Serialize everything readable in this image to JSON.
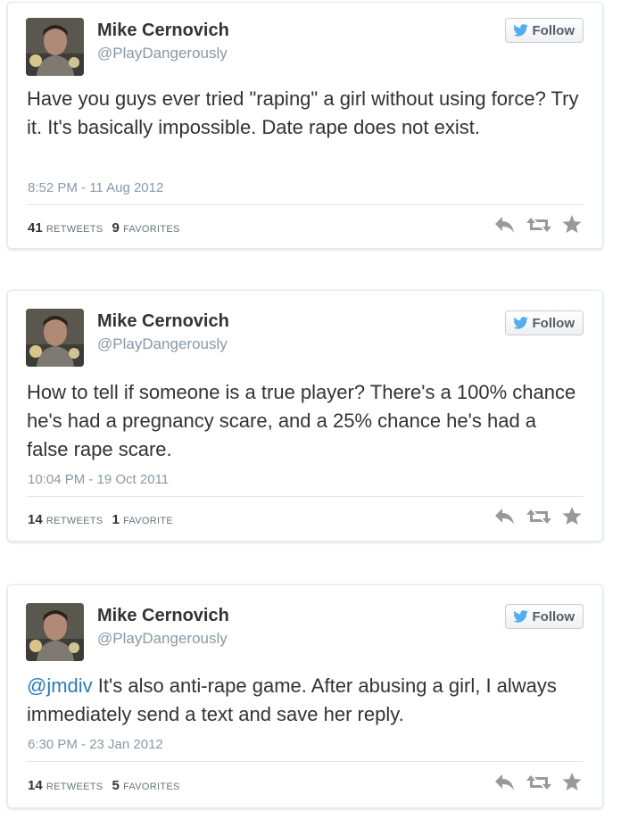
{
  "tweets": [
    {
      "name": "Mike Cernovich",
      "handle": "@PlayDangerously",
      "follow_label": "Follow",
      "text": "Have you guys ever tried \"raping\" a girl without using force? Try it. It's basically impossible. Date rape does not exist.",
      "timestamp": "8:52 PM - 11 Aug 2012",
      "retweets_count": "41",
      "retweets_label": "Retweets",
      "favorites_count": "9",
      "favorites_label": "Favorites"
    },
    {
      "name": "Mike Cernovich",
      "handle": "@PlayDangerously",
      "follow_label": "Follow",
      "text": "How to tell if someone is a true player? There's a 100% chance he's had a pregnancy scare, and a 25% chance he's had a false rape scare.",
      "timestamp": "10:04 PM - 19 Oct 2011",
      "retweets_count": "14",
      "retweets_label": "Retweets",
      "favorites_count": "1",
      "favorites_label": "Favorite"
    },
    {
      "name": "Mike Cernovich",
      "handle": "@PlayDangerously",
      "follow_label": "Follow",
      "mention": "@jmdiv",
      "text": "It's also anti-rape game. After abusing a girl, I always immediately send a text and save her reply.",
      "timestamp": "6:30 PM - 23 Jan 2012",
      "retweets_count": "14",
      "retweets_label": "Retweets",
      "favorites_count": "5",
      "favorites_label": "Favorites"
    }
  ],
  "icons": {
    "follow": "twitter-bird-icon",
    "reply": "reply-icon",
    "retweet": "retweet-icon",
    "favorite": "star-icon"
  },
  "colors": {
    "link": "#2b7bb9",
    "bird": "#55acee",
    "muted": "#8899a6",
    "action_icon": "#999999"
  }
}
